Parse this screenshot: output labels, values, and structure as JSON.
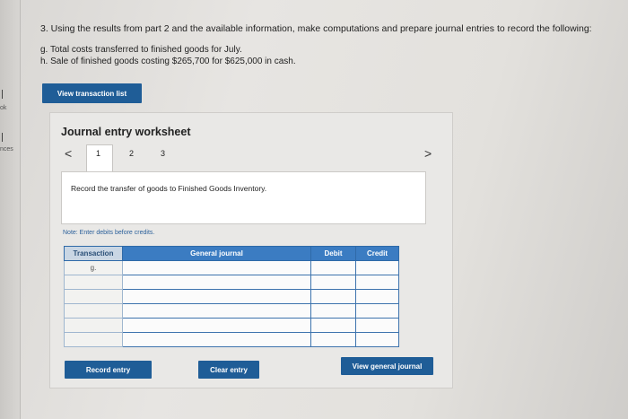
{
  "left_strip": {
    "text_1": "ok",
    "text_2": "nces"
  },
  "question": {
    "main": "3. Using the results from part 2 and the available information, make computations and prepare journal entries to record the following:",
    "g": "g. Total costs transferred to finished goods for July.",
    "h": "h. Sale of finished goods costing $265,700 for $625,000 in cash."
  },
  "view_transaction_label": "View transaction list",
  "worksheet": {
    "title": "Journal entry worksheet",
    "pages": [
      "1",
      "2",
      "3"
    ],
    "prev_glyph": "<",
    "next_glyph": ">",
    "instruction": "Record the transfer of goods to Finished Goods Inventory.",
    "note": "Note: Enter debits before credits.",
    "table": {
      "headers": [
        "Transaction",
        "General journal",
        "Debit",
        "Credit"
      ],
      "rows": [
        [
          "g.",
          "",
          "",
          ""
        ],
        [
          "",
          "",
          "",
          ""
        ],
        [
          "",
          "",
          "",
          ""
        ],
        [
          "",
          "",
          "",
          ""
        ],
        [
          "",
          "",
          "",
          ""
        ],
        [
          "",
          "",
          "",
          ""
        ]
      ]
    },
    "buttons": {
      "record": "Record entry",
      "clear": "Clear entry",
      "view_journal": "View general journal"
    }
  },
  "colors": {
    "accent": "#1f5d97",
    "table_header": "#3b7cc2"
  }
}
